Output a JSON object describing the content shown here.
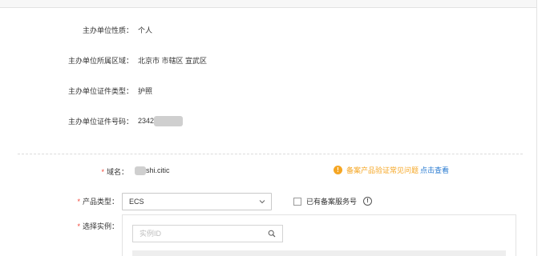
{
  "info": {
    "org_type_label": "主办单位性质：",
    "org_type_value": "个人",
    "region_label": "主办单位所属区域：",
    "region_value": "北京市 市辖区 宣武区",
    "id_type_label": "主办单位证件类型：",
    "id_type_value": "护照",
    "id_number_label": "主办单位证件号码：",
    "id_number_value": "2342"
  },
  "form": {
    "required_mark": "*",
    "domain_label": "域名：",
    "domain_value": "shi.citic",
    "faq_icon": "!",
    "faq_text": "备案产品验证常见问题",
    "faq_link": "点击查看",
    "product_type_label": "产品类型：",
    "product_type_value": "ECS",
    "has_service_number_label": "已有备案服务号",
    "info_icon": "!",
    "select_instance_label": "选择实例：",
    "instance_search_placeholder": "实例ID"
  },
  "icons": {
    "faq": "warning-circle-icon",
    "select": "chevron-down-icon",
    "info": "info-circle-icon",
    "search": "search-icon"
  },
  "colors": {
    "required": "#f04134",
    "warning": "#f5a623",
    "link": "#2a7bd1"
  }
}
